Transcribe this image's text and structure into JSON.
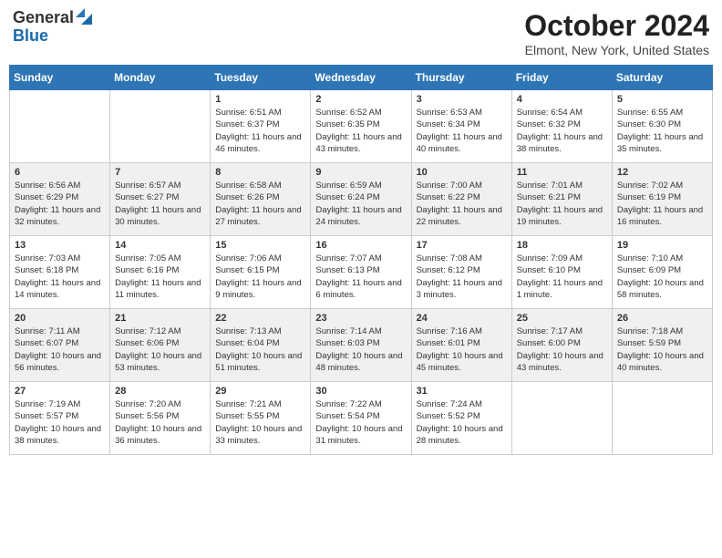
{
  "header": {
    "logo_general": "General",
    "logo_blue": "Blue",
    "month": "October 2024",
    "location": "Elmont, New York, United States"
  },
  "days_of_week": [
    "Sunday",
    "Monday",
    "Tuesday",
    "Wednesday",
    "Thursday",
    "Friday",
    "Saturday"
  ],
  "weeks": [
    [
      {
        "day": "",
        "content": ""
      },
      {
        "day": "",
        "content": ""
      },
      {
        "day": "1",
        "content": "Sunrise: 6:51 AM\nSunset: 6:37 PM\nDaylight: 11 hours and 46 minutes."
      },
      {
        "day": "2",
        "content": "Sunrise: 6:52 AM\nSunset: 6:35 PM\nDaylight: 11 hours and 43 minutes."
      },
      {
        "day": "3",
        "content": "Sunrise: 6:53 AM\nSunset: 6:34 PM\nDaylight: 11 hours and 40 minutes."
      },
      {
        "day": "4",
        "content": "Sunrise: 6:54 AM\nSunset: 6:32 PM\nDaylight: 11 hours and 38 minutes."
      },
      {
        "day": "5",
        "content": "Sunrise: 6:55 AM\nSunset: 6:30 PM\nDaylight: 11 hours and 35 minutes."
      }
    ],
    [
      {
        "day": "6",
        "content": "Sunrise: 6:56 AM\nSunset: 6:29 PM\nDaylight: 11 hours and 32 minutes."
      },
      {
        "day": "7",
        "content": "Sunrise: 6:57 AM\nSunset: 6:27 PM\nDaylight: 11 hours and 30 minutes."
      },
      {
        "day": "8",
        "content": "Sunrise: 6:58 AM\nSunset: 6:26 PM\nDaylight: 11 hours and 27 minutes."
      },
      {
        "day": "9",
        "content": "Sunrise: 6:59 AM\nSunset: 6:24 PM\nDaylight: 11 hours and 24 minutes."
      },
      {
        "day": "10",
        "content": "Sunrise: 7:00 AM\nSunset: 6:22 PM\nDaylight: 11 hours and 22 minutes."
      },
      {
        "day": "11",
        "content": "Sunrise: 7:01 AM\nSunset: 6:21 PM\nDaylight: 11 hours and 19 minutes."
      },
      {
        "day": "12",
        "content": "Sunrise: 7:02 AM\nSunset: 6:19 PM\nDaylight: 11 hours and 16 minutes."
      }
    ],
    [
      {
        "day": "13",
        "content": "Sunrise: 7:03 AM\nSunset: 6:18 PM\nDaylight: 11 hours and 14 minutes."
      },
      {
        "day": "14",
        "content": "Sunrise: 7:05 AM\nSunset: 6:16 PM\nDaylight: 11 hours and 11 minutes."
      },
      {
        "day": "15",
        "content": "Sunrise: 7:06 AM\nSunset: 6:15 PM\nDaylight: 11 hours and 9 minutes."
      },
      {
        "day": "16",
        "content": "Sunrise: 7:07 AM\nSunset: 6:13 PM\nDaylight: 11 hours and 6 minutes."
      },
      {
        "day": "17",
        "content": "Sunrise: 7:08 AM\nSunset: 6:12 PM\nDaylight: 11 hours and 3 minutes."
      },
      {
        "day": "18",
        "content": "Sunrise: 7:09 AM\nSunset: 6:10 PM\nDaylight: 11 hours and 1 minute."
      },
      {
        "day": "19",
        "content": "Sunrise: 7:10 AM\nSunset: 6:09 PM\nDaylight: 10 hours and 58 minutes."
      }
    ],
    [
      {
        "day": "20",
        "content": "Sunrise: 7:11 AM\nSunset: 6:07 PM\nDaylight: 10 hours and 56 minutes."
      },
      {
        "day": "21",
        "content": "Sunrise: 7:12 AM\nSunset: 6:06 PM\nDaylight: 10 hours and 53 minutes."
      },
      {
        "day": "22",
        "content": "Sunrise: 7:13 AM\nSunset: 6:04 PM\nDaylight: 10 hours and 51 minutes."
      },
      {
        "day": "23",
        "content": "Sunrise: 7:14 AM\nSunset: 6:03 PM\nDaylight: 10 hours and 48 minutes."
      },
      {
        "day": "24",
        "content": "Sunrise: 7:16 AM\nSunset: 6:01 PM\nDaylight: 10 hours and 45 minutes."
      },
      {
        "day": "25",
        "content": "Sunrise: 7:17 AM\nSunset: 6:00 PM\nDaylight: 10 hours and 43 minutes."
      },
      {
        "day": "26",
        "content": "Sunrise: 7:18 AM\nSunset: 5:59 PM\nDaylight: 10 hours and 40 minutes."
      }
    ],
    [
      {
        "day": "27",
        "content": "Sunrise: 7:19 AM\nSunset: 5:57 PM\nDaylight: 10 hours and 38 minutes."
      },
      {
        "day": "28",
        "content": "Sunrise: 7:20 AM\nSunset: 5:56 PM\nDaylight: 10 hours and 36 minutes."
      },
      {
        "day": "29",
        "content": "Sunrise: 7:21 AM\nSunset: 5:55 PM\nDaylight: 10 hours and 33 minutes."
      },
      {
        "day": "30",
        "content": "Sunrise: 7:22 AM\nSunset: 5:54 PM\nDaylight: 10 hours and 31 minutes."
      },
      {
        "day": "31",
        "content": "Sunrise: 7:24 AM\nSunset: 5:52 PM\nDaylight: 10 hours and 28 minutes."
      },
      {
        "day": "",
        "content": ""
      },
      {
        "day": "",
        "content": ""
      }
    ]
  ]
}
